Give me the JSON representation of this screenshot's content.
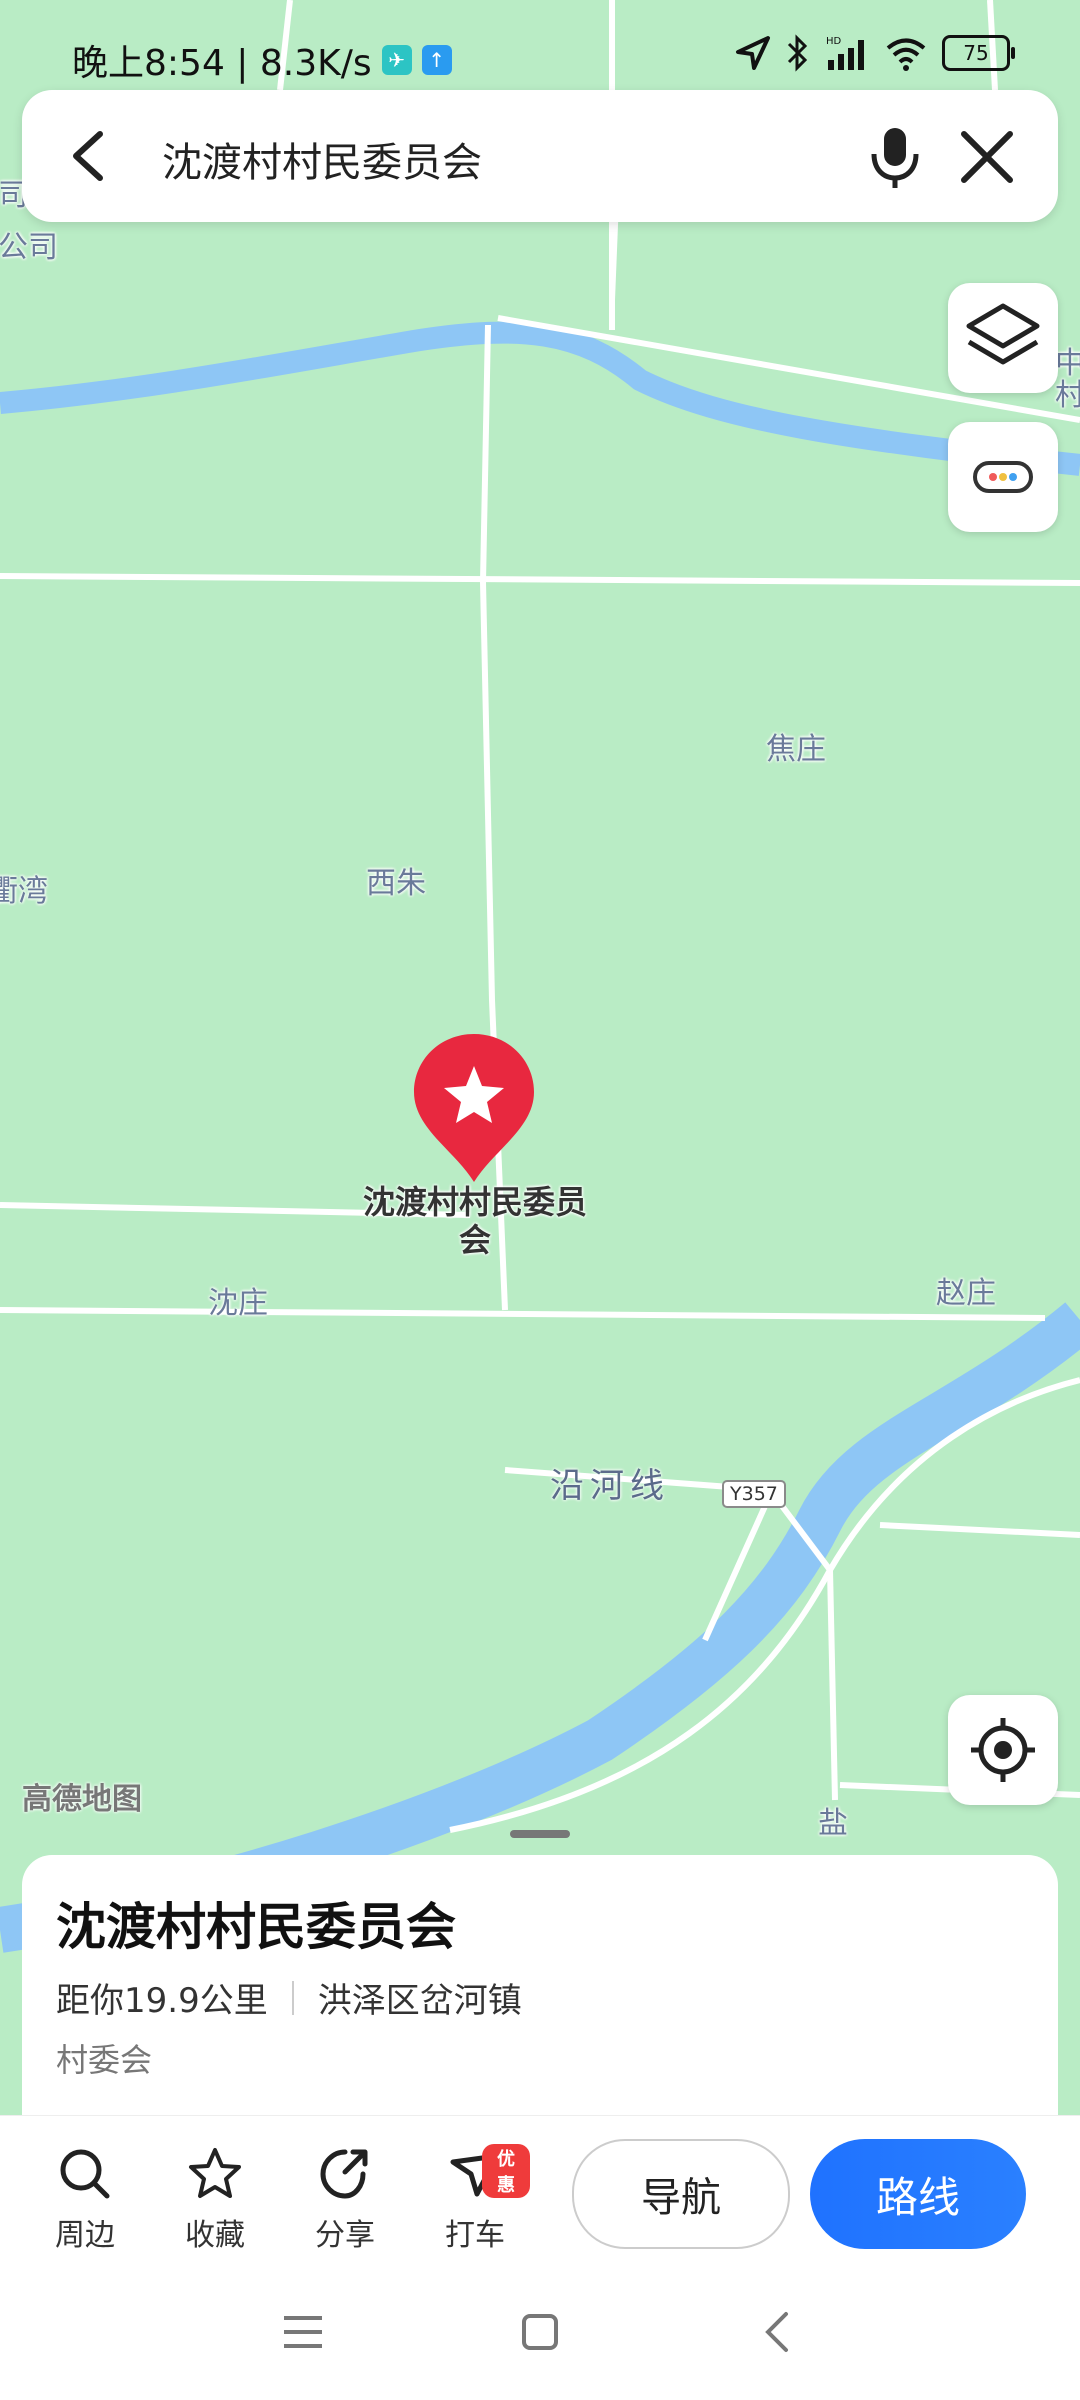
{
  "status_bar": {
    "time_speed": "晚上8:54 | 8.3K/s",
    "battery": "75",
    "network_label": "HD"
  },
  "search": {
    "query": "沈渡村村民委员会"
  },
  "map": {
    "place_labels": [
      "焦庄",
      "西朱",
      "衢湾",
      "沈庄",
      "赵庄",
      "盐",
      "中",
      "村",
      "司",
      "公司"
    ],
    "poi_label": "沈渡村村民委员会",
    "road_name": "沿河线",
    "road_shield": "Y357",
    "watermark": "高德地图"
  },
  "place_card": {
    "title": "沈渡村村民委员会",
    "distance": "距你19.9公里",
    "region": "洪泽区岔河镇",
    "category": "村委会"
  },
  "actions": {
    "nearby": "周边",
    "favorite": "收藏",
    "share": "分享",
    "taxi": "打车",
    "taxi_badge": "优惠",
    "navigate": "导航",
    "route": "路线"
  },
  "colors": {
    "map_bg": "#b9ecc5",
    "river": "#8ec6f5",
    "accent": "#1f72ff",
    "poi_red": "#e8283f"
  }
}
